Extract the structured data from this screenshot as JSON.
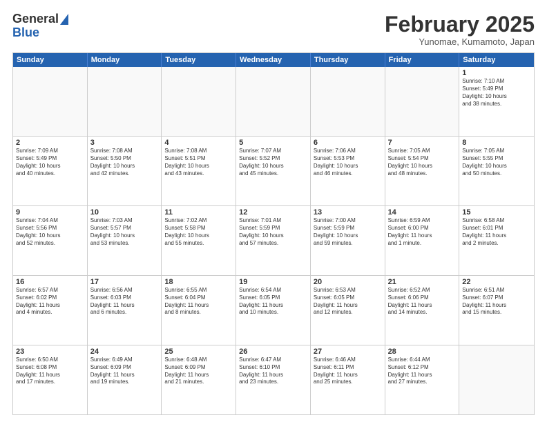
{
  "header": {
    "logo_line1": "General",
    "logo_line2": "Blue",
    "month": "February 2025",
    "location": "Yunomae, Kumamoto, Japan"
  },
  "weekdays": [
    "Sunday",
    "Monday",
    "Tuesday",
    "Wednesday",
    "Thursday",
    "Friday",
    "Saturday"
  ],
  "weeks": [
    [
      {
        "day": "",
        "info": ""
      },
      {
        "day": "",
        "info": ""
      },
      {
        "day": "",
        "info": ""
      },
      {
        "day": "",
        "info": ""
      },
      {
        "day": "",
        "info": ""
      },
      {
        "day": "",
        "info": ""
      },
      {
        "day": "1",
        "info": "Sunrise: 7:10 AM\nSunset: 5:49 PM\nDaylight: 10 hours\nand 38 minutes."
      }
    ],
    [
      {
        "day": "2",
        "info": "Sunrise: 7:09 AM\nSunset: 5:49 PM\nDaylight: 10 hours\nand 40 minutes."
      },
      {
        "day": "3",
        "info": "Sunrise: 7:08 AM\nSunset: 5:50 PM\nDaylight: 10 hours\nand 42 minutes."
      },
      {
        "day": "4",
        "info": "Sunrise: 7:08 AM\nSunset: 5:51 PM\nDaylight: 10 hours\nand 43 minutes."
      },
      {
        "day": "5",
        "info": "Sunrise: 7:07 AM\nSunset: 5:52 PM\nDaylight: 10 hours\nand 45 minutes."
      },
      {
        "day": "6",
        "info": "Sunrise: 7:06 AM\nSunset: 5:53 PM\nDaylight: 10 hours\nand 46 minutes."
      },
      {
        "day": "7",
        "info": "Sunrise: 7:05 AM\nSunset: 5:54 PM\nDaylight: 10 hours\nand 48 minutes."
      },
      {
        "day": "8",
        "info": "Sunrise: 7:05 AM\nSunset: 5:55 PM\nDaylight: 10 hours\nand 50 minutes."
      }
    ],
    [
      {
        "day": "9",
        "info": "Sunrise: 7:04 AM\nSunset: 5:56 PM\nDaylight: 10 hours\nand 52 minutes."
      },
      {
        "day": "10",
        "info": "Sunrise: 7:03 AM\nSunset: 5:57 PM\nDaylight: 10 hours\nand 53 minutes."
      },
      {
        "day": "11",
        "info": "Sunrise: 7:02 AM\nSunset: 5:58 PM\nDaylight: 10 hours\nand 55 minutes."
      },
      {
        "day": "12",
        "info": "Sunrise: 7:01 AM\nSunset: 5:59 PM\nDaylight: 10 hours\nand 57 minutes."
      },
      {
        "day": "13",
        "info": "Sunrise: 7:00 AM\nSunset: 5:59 PM\nDaylight: 10 hours\nand 59 minutes."
      },
      {
        "day": "14",
        "info": "Sunrise: 6:59 AM\nSunset: 6:00 PM\nDaylight: 11 hours\nand 1 minute."
      },
      {
        "day": "15",
        "info": "Sunrise: 6:58 AM\nSunset: 6:01 PM\nDaylight: 11 hours\nand 2 minutes."
      }
    ],
    [
      {
        "day": "16",
        "info": "Sunrise: 6:57 AM\nSunset: 6:02 PM\nDaylight: 11 hours\nand 4 minutes."
      },
      {
        "day": "17",
        "info": "Sunrise: 6:56 AM\nSunset: 6:03 PM\nDaylight: 11 hours\nand 6 minutes."
      },
      {
        "day": "18",
        "info": "Sunrise: 6:55 AM\nSunset: 6:04 PM\nDaylight: 11 hours\nand 8 minutes."
      },
      {
        "day": "19",
        "info": "Sunrise: 6:54 AM\nSunset: 6:05 PM\nDaylight: 11 hours\nand 10 minutes."
      },
      {
        "day": "20",
        "info": "Sunrise: 6:53 AM\nSunset: 6:05 PM\nDaylight: 11 hours\nand 12 minutes."
      },
      {
        "day": "21",
        "info": "Sunrise: 6:52 AM\nSunset: 6:06 PM\nDaylight: 11 hours\nand 14 minutes."
      },
      {
        "day": "22",
        "info": "Sunrise: 6:51 AM\nSunset: 6:07 PM\nDaylight: 11 hours\nand 15 minutes."
      }
    ],
    [
      {
        "day": "23",
        "info": "Sunrise: 6:50 AM\nSunset: 6:08 PM\nDaylight: 11 hours\nand 17 minutes."
      },
      {
        "day": "24",
        "info": "Sunrise: 6:49 AM\nSunset: 6:09 PM\nDaylight: 11 hours\nand 19 minutes."
      },
      {
        "day": "25",
        "info": "Sunrise: 6:48 AM\nSunset: 6:09 PM\nDaylight: 11 hours\nand 21 minutes."
      },
      {
        "day": "26",
        "info": "Sunrise: 6:47 AM\nSunset: 6:10 PM\nDaylight: 11 hours\nand 23 minutes."
      },
      {
        "day": "27",
        "info": "Sunrise: 6:46 AM\nSunset: 6:11 PM\nDaylight: 11 hours\nand 25 minutes."
      },
      {
        "day": "28",
        "info": "Sunrise: 6:44 AM\nSunset: 6:12 PM\nDaylight: 11 hours\nand 27 minutes."
      },
      {
        "day": "",
        "info": ""
      }
    ]
  ]
}
